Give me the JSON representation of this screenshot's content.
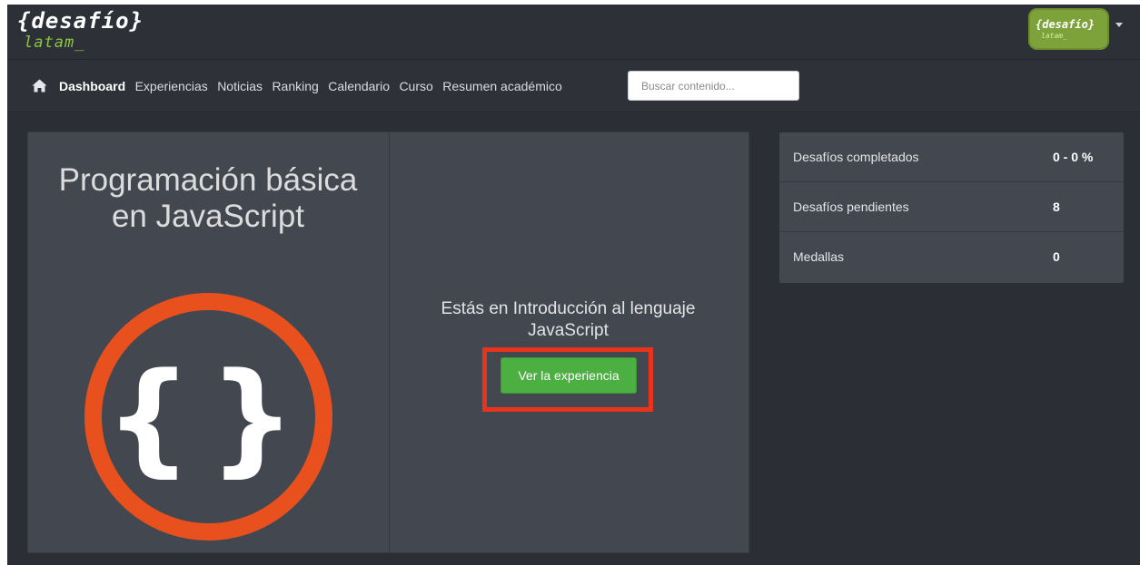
{
  "header": {
    "logo_main": "{desafío}",
    "logo_sub": "latam_",
    "avatar_main": "{desafío}",
    "avatar_sub": "latam_"
  },
  "nav": {
    "items": [
      {
        "label": "Dashboard",
        "active": true
      },
      {
        "label": "Experiencias"
      },
      {
        "label": "Noticias"
      },
      {
        "label": "Ranking"
      },
      {
        "label": "Calendario"
      },
      {
        "label": "Curso"
      },
      {
        "label": "Resumen académico"
      }
    ],
    "search_placeholder": "Buscar contenido..."
  },
  "course": {
    "title": "Programación básica en JavaScript",
    "current_text": "Estás en Introducción al lenguaje JavaScript",
    "button_label": "Ver la experiencia"
  },
  "stats": [
    {
      "label": "Desafíos completados",
      "value": "0 - 0 %"
    },
    {
      "label": "Desafíos pendientes",
      "value": "8"
    },
    {
      "label": "Medallas",
      "value": "0"
    }
  ],
  "colors": {
    "accent_green": "#4caf42",
    "brand_green": "#8cc63f",
    "ring_orange": "#e8501e",
    "highlight_red": "#e8341c"
  },
  "icons": {
    "home": "home-icon",
    "course": "curly-braces-icon",
    "menu": "caret-down-icon"
  }
}
